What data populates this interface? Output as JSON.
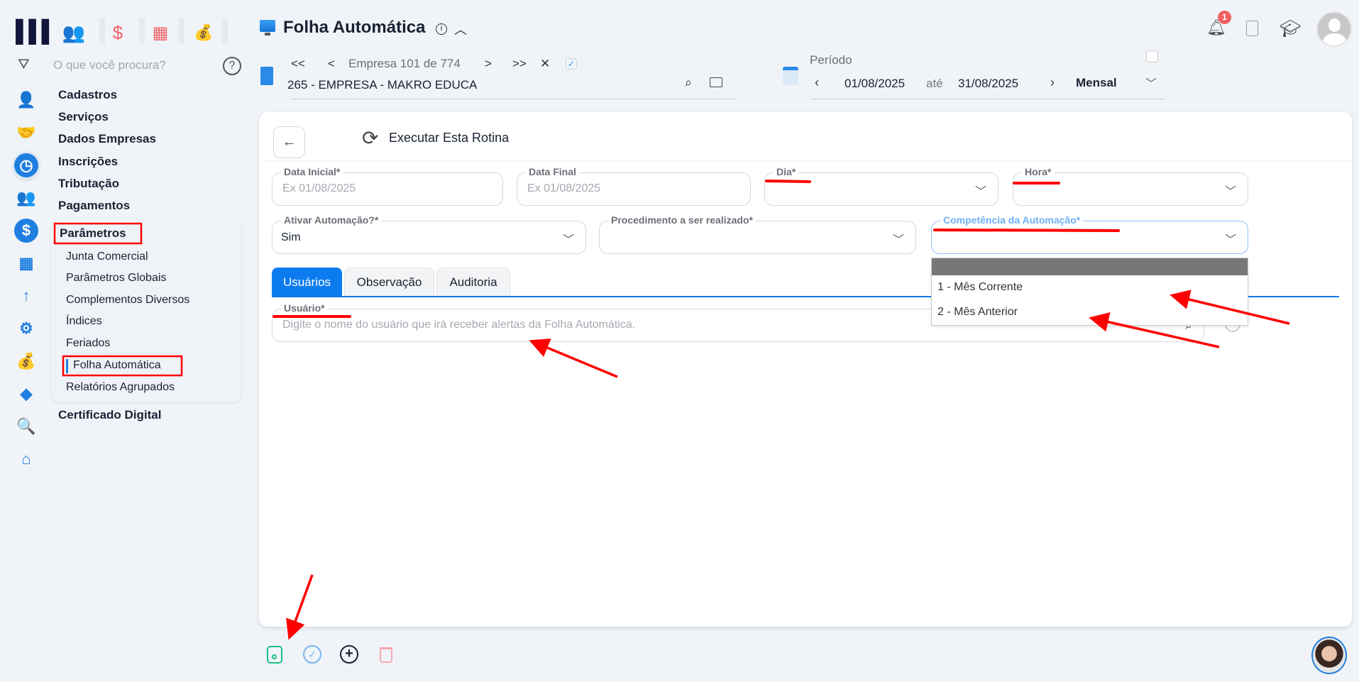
{
  "header": {
    "title": "Folha Automática",
    "empresa_nav": "Empresa 101 de 774",
    "empresa_name": "265 - EMPRESA - MAKRO EDUCA",
    "periodo_label": "Período",
    "date_from": "01/08/2025",
    "date_sep": "até",
    "date_to": "31/08/2025",
    "period_type": "Mensal",
    "notification_count": "1",
    "nav_first": "<<",
    "nav_prev": "<",
    "nav_next": ">",
    "nav_last": ">>",
    "close": "✕"
  },
  "sidebar": {
    "search_placeholder": "O que você procura?",
    "menu": [
      "Cadastros",
      "Serviços",
      "Dados Empresas",
      "Inscrições",
      "Tributação",
      "Pagamentos"
    ],
    "section": "Parâmetros",
    "subitems": [
      "Junta Comercial",
      "Parâmetros Globais",
      "Complementos Diversos",
      "Índices",
      "Feriados",
      "Folha Automática",
      "Relatórios Agrupados"
    ],
    "after": "Certificado Digital"
  },
  "toolbar": {
    "execute_label": "Executar Esta Rotina"
  },
  "form": {
    "data_inicial": {
      "label": "Data Inicial*",
      "placeholder": "Ex 01/08/2025"
    },
    "data_final": {
      "label": "Data Final",
      "placeholder": "Ex 01/08/2025"
    },
    "dia": {
      "label": "Dia*",
      "value": ""
    },
    "hora": {
      "label": "Hora*",
      "value": ""
    },
    "ativar": {
      "label": "Ativar Automação?*",
      "value": "Sim"
    },
    "procedimento": {
      "label": "Procedimento a ser realizado*",
      "value": ""
    },
    "competencia": {
      "label": "Competência da Automação*",
      "value": "",
      "options": [
        "1 - Mês Corrente",
        "2 - Mês Anterior"
      ]
    }
  },
  "tabs": [
    "Usuários",
    "Observação",
    "Auditoria"
  ],
  "usuario": {
    "label": "Usuário*",
    "placeholder": "Digite o nome do usuário que irá receber alertas da Folha Automática."
  },
  "colors": {
    "accent": "#0d7bf0",
    "annotation": "#ff0000",
    "save": "#1bbf83"
  }
}
